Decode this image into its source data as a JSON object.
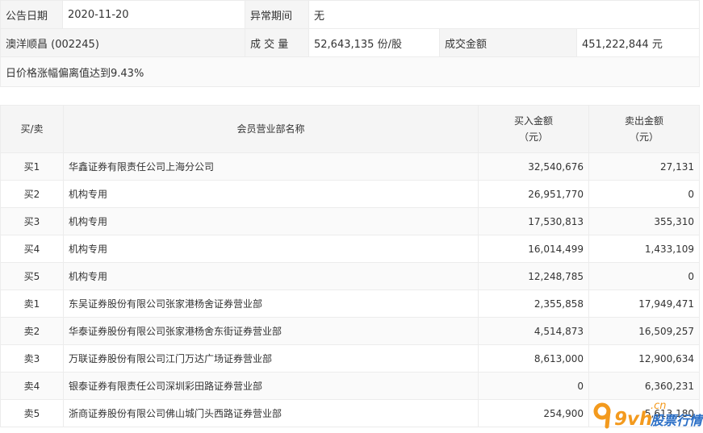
{
  "announcement": {
    "date_label": "公告日期",
    "date": "2020-11-20",
    "abnormal_period_label": "异常期间",
    "abnormal_period": "无",
    "stock_name": "澳洋顺昌 (002245)",
    "volume_label": "成 交 量",
    "volume": "52,643,135 份/股",
    "turnover_label": "成交金额",
    "turnover": "451,222,844 元",
    "reason": "日价格涨幅偏离值达到9.43%"
  },
  "table": {
    "headers": {
      "side": "买/卖",
      "member": "会员营业部名称",
      "buy_amount": "买入金额",
      "sell_amount": "卖出金额",
      "unit": "（元）"
    },
    "rows": [
      {
        "side": "买1",
        "member": "华鑫证券有限责任公司上海分公司",
        "buy": "32,540,676",
        "sell": "27,131"
      },
      {
        "side": "买2",
        "member": "机构专用",
        "buy": "26,951,770",
        "sell": "0"
      },
      {
        "side": "买3",
        "member": "机构专用",
        "buy": "17,530,813",
        "sell": "355,310"
      },
      {
        "side": "买4",
        "member": "机构专用",
        "buy": "16,014,499",
        "sell": "1,433,109"
      },
      {
        "side": "买5",
        "member": "机构专用",
        "buy": "12,248,785",
        "sell": "0"
      },
      {
        "side": "卖1",
        "member": "东吴证券股份有限公司张家港杨舍证券营业部",
        "buy": "2,355,858",
        "sell": "17,949,471"
      },
      {
        "side": "卖2",
        "member": "华泰证券股份有限公司张家港杨舍东街证券营业部",
        "buy": "4,514,873",
        "sell": "16,509,257"
      },
      {
        "side": "卖3",
        "member": "万联证券股份有限公司江门万达广场证券营业部",
        "buy": "8,613,000",
        "sell": "12,900,634"
      },
      {
        "side": "卖4",
        "member": "银泰证券有限责任公司深圳彩田路证券营业部",
        "buy": "0",
        "sell": "6,360,231"
      },
      {
        "side": "卖5",
        "member": "浙商证券股份有限公司佛山城门头西路证券营业部",
        "buy": "254,900",
        "sell": "5,613,180"
      }
    ]
  },
  "watermark": {
    "logo_text": "9vh",
    "domain": ".cn",
    "slogan": "股票行情",
    "colors": {
      "orange": "#f39a1e",
      "blue": "#2b6fc6"
    }
  }
}
